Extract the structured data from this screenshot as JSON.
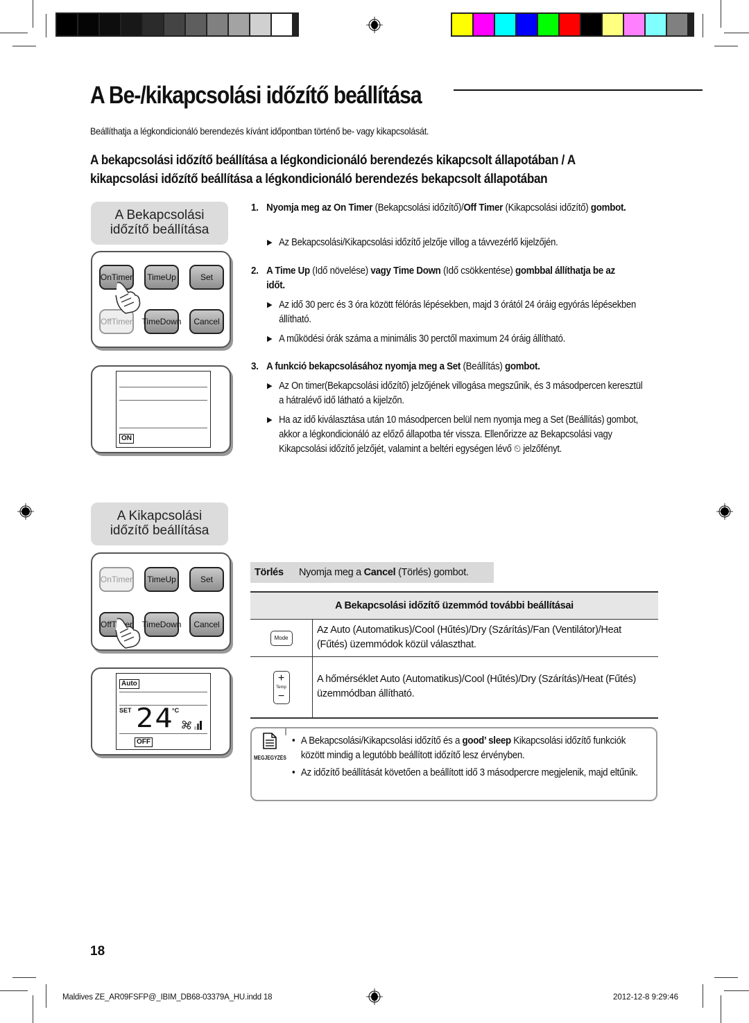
{
  "print_marks": {
    "grayscale_swatches": [
      "#000000",
      "#050505",
      "#0d0d0d",
      "#181818",
      "#2b2b2b",
      "#444444",
      "#5e5e5e",
      "#808080",
      "#a3a3a3",
      "#d0d0d0",
      "#ffffff"
    ],
    "color_swatches": [
      "#ffff00",
      "#ff00ff",
      "#00ffff",
      "#0000ff",
      "#00ff00",
      "#ff0000",
      "#000000",
      "#ffff80",
      "#ff80ff",
      "#80ffff",
      "#808080"
    ]
  },
  "page": {
    "title": "A Be-/kikapcsolási időzítő beállítása",
    "intro": "Beállíthatja a légkondicionáló berendezés kívánt időpontban történő be- vagy kikapcsolását.",
    "subheading": "A bekapcsolási időzítő beállítása a légkondicionáló berendezés kikapcsolt állapotában / A kikapcsolási időzítő beállítása a légkondicionáló berendezés bekapcsolt állapotában"
  },
  "on_timer_panel": {
    "label_line1": "A Bekapcsolási",
    "label_line2": "időzítő beállítása",
    "buttons": {
      "on_timer": [
        "On",
        "Timer"
      ],
      "time_up": [
        "Time",
        "Up"
      ],
      "set": "Set",
      "off_timer": [
        "Off",
        "Timer"
      ],
      "time_down": [
        "Time",
        "Down"
      ],
      "cancel": "Cancel"
    },
    "display_tag": "ON"
  },
  "off_timer_panel": {
    "label_line1": "A Kikapcsolási",
    "label_line2": "időzítő beállítása",
    "buttons": {
      "on_timer": [
        "On",
        "Timer"
      ],
      "time_up": [
        "Time",
        "Up"
      ],
      "set": "Set",
      "off_timer": [
        "Off",
        "Timer"
      ],
      "time_down": [
        "Time",
        "Down"
      ],
      "cancel": "Cancel"
    },
    "display": {
      "mode_tag": "Auto",
      "set_label": "SET",
      "temperature": "24",
      "unit": "°C",
      "off_tag": "OFF"
    }
  },
  "steps": [
    {
      "num": "1.",
      "parts": [
        {
          "t": "Nyomja meg az ",
          "b": true
        },
        {
          "t": "On Timer",
          "b": true
        },
        {
          "t": " (Bekapcsolási időzítő)/",
          "b": false
        },
        {
          "t": "Off Timer",
          "b": true
        },
        {
          "t": " (Kikapcsolási időzítő) ",
          "b": false
        },
        {
          "t": "gombot.",
          "b": true
        }
      ],
      "bullets": [
        "Az Bekapcsolási/Kikapcsolási időzítő jelzője villog a távvezérlő kijelzőjén."
      ]
    },
    {
      "num": "2.",
      "parts": [
        {
          "t": "A ",
          "b": true
        },
        {
          "t": "Time Up",
          "b": true
        },
        {
          "t": " (Idő növelése) ",
          "b": false
        },
        {
          "t": "vagy ",
          "b": true
        },
        {
          "t": "Time Down",
          "b": true
        },
        {
          "t": " (Idő csökkentése) ",
          "b": false
        },
        {
          "t": "gombbal állíthatja be az időt.",
          "b": true
        }
      ],
      "bullets": [
        "Az idő 30 perc és 3 óra között félórás lépésekben, majd 3 órától 24 óráig egyórás lépésekben állítható.",
        "A működési órák száma a minimális 30 perctől maximum 24 óráig állítható."
      ]
    },
    {
      "num": "3.",
      "parts": [
        {
          "t": "A funkció bekapcsolásához nyomja meg a ",
          "b": true
        },
        {
          "t": "Set",
          "b": true
        },
        {
          "t": " (Beállítás) ",
          "b": false
        },
        {
          "t": "gombot.",
          "b": true
        }
      ],
      "bullets": [
        "Az On timer(Bekapcsolási időzítő) jelzőjének villogása megszűnik, és 3 másodpercen keresztül a hátralévő idő látható a kijelzőn.",
        "Ha az idő kiválasztása után 10 másodpercen belül nem nyomja meg a Set (Beállítás) gombot, akkor a légkondicionáló az előző állapotba tér vissza. Ellenőrizze az Bekapcsolási vagy Kikapcsolási időzítő jelzőjét, valamint a beltéri egységen lévő ⏲ jelzőfényt."
      ]
    }
  ],
  "cancel_row": {
    "label": "Törlés",
    "text_before": "Nyomja meg a ",
    "button": "Cancel",
    "text_after": " (Törlés) gombot."
  },
  "settings_table": {
    "header": "A Bekapcsolási időzítő üzemmód további beállításai",
    "rows": [
      {
        "icon": "mode-button-icon",
        "icon_label": "Mode",
        "text": "Az Auto (Automatikus)/Cool (Hűtés)/Dry (Szárítás)/Fan (Ventilátor)/Heat (Fűtés) üzemmódok közül választhat."
      },
      {
        "icon": "temp-button-icon",
        "icon_label": "Temp",
        "text": "A hőmérséklet Auto (Automatikus)/Cool (Hűtés)/Dry (Szárítás)/Heat (Fűtés) üzemmódban állítható."
      }
    ]
  },
  "note": {
    "label": "MEGJEGYZÉS",
    "items": [
      {
        "before": "A Bekapcsolási/Kikapcsolási időzítő és a ",
        "bold": "good’ sleep",
        "after": " Kikapcsolási időzítő funkciók között mindig a legutóbb beállított időzítő lesz érvényben."
      },
      {
        "before": "Az időzítő beállítását követően a beállított idő 3 másodpercre megjelenik, majd eltűnik.",
        "bold": "",
        "after": ""
      }
    ]
  },
  "page_number": "18",
  "footer": {
    "file": "Maldives ZE_AR09FSFP@_IBIM_DB68-03379A_HU.indd   18",
    "timestamp": "2012-12-8   9:29:46"
  }
}
